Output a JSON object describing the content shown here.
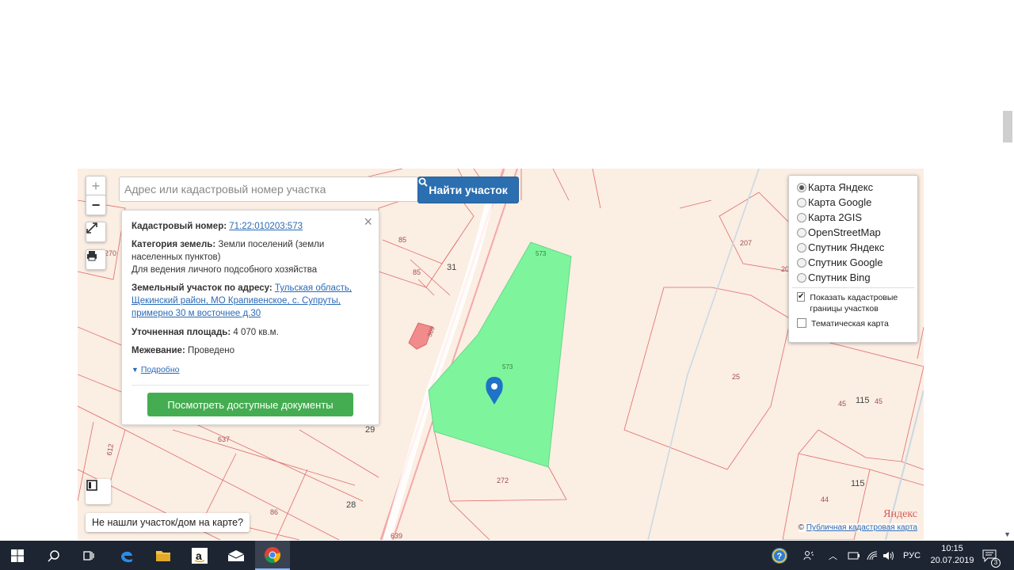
{
  "search": {
    "placeholder": "Адрес или кадастровый номер участка",
    "button_label": "Найти участок"
  },
  "zoom": {
    "plus": "+",
    "minus": "−"
  },
  "info_card": {
    "cadastral_label": "Кадастровый номер:",
    "cadastral_number": "71:22:010203:573",
    "category_label": "Категория земель:",
    "category_value": "Земли поселений (земли населенных пунктов)",
    "usage": "Для ведения личного подсобного хозяйства",
    "address_label": "Земельный участок по адресу:",
    "address_value": "Тульская область, Щекинский район, МО Крапивенское, с. Супруты, примерно 30 м восточнее д.30",
    "area_label": "Уточненная площадь:",
    "area_value": "4 070 кв.м.",
    "survey_label": "Межевание:",
    "survey_value": "Проведено",
    "details_link": "Подробно",
    "docs_button": "Посмотреть доступные документы"
  },
  "layers": {
    "options": [
      "Карта Яндекс",
      "Карта Google",
      "Карта 2GIS",
      "OpenStreetMap",
      "Спутник Яндекс",
      "Спутник Google",
      "Спутник Bing"
    ],
    "selected": "Карта Яндекс",
    "show_borders": "Показать кадастровые границы участков",
    "show_borders_checked": true,
    "thematic": "Тематическая карта",
    "thematic_checked": false
  },
  "map_labels": {
    "l85a": "85",
    "l85b": "85",
    "l31": "31",
    "l573top": "573",
    "l573": "573",
    "l207": "207",
    "l20": "20",
    "l270": "270",
    "l25": "25",
    "l45a": "45",
    "l115": "115",
    "l45b": "45",
    "l637": "637",
    "l612": "612",
    "l29": "29",
    "l272": "272",
    "l28": "28",
    "l86": "86",
    "l639": "639",
    "l44": "44",
    "l115b": "115",
    "l369": "369"
  },
  "not_found": "Не нашли участок/дом на карте?",
  "attribution": {
    "prefix": "©",
    "link": "Публичная кадастровая карта"
  },
  "yandex_logo": "Яндекс",
  "taskbar": {
    "lang": "РУС",
    "time": "10:15",
    "date": "20.07.2019",
    "notifications": "3"
  },
  "colors": {
    "parcel_fill": "#7ef59d",
    "search_button": "#2c6fb0",
    "docs_button": "#45ad51",
    "map_background": "#fbeee3",
    "taskbar": "#1d2533"
  }
}
